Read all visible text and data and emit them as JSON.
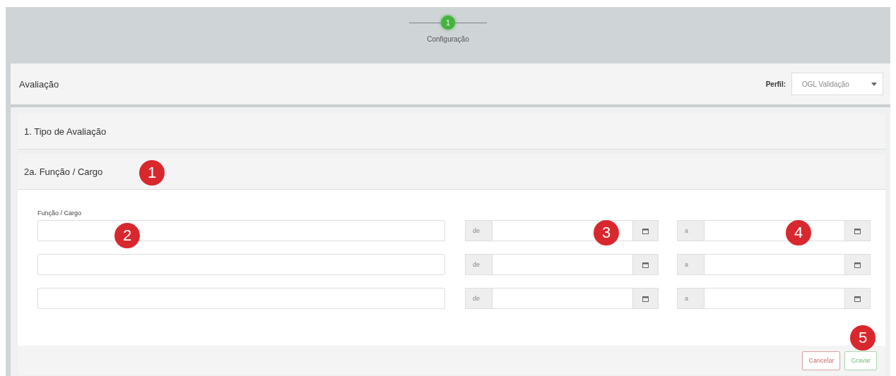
{
  "stepper": {
    "steps": [
      {
        "number": "1",
        "label": "Configuração",
        "selected": true
      }
    ]
  },
  "panel": {
    "title": "Avaliação",
    "profile_label": "Perfil:",
    "profile_value": "OGL Validação"
  },
  "sections": [
    {
      "title": "1. Tipo de Avaliação"
    },
    {
      "title": "2a. Função / Cargo",
      "field_label": "Função / Cargo",
      "rows": [
        {
          "from_prefix": "de",
          "to_prefix": "a"
        },
        {
          "from_prefix": "de",
          "to_prefix": "a"
        },
        {
          "from_prefix": "de",
          "to_prefix": "a"
        }
      ]
    }
  ],
  "buttons": [
    {
      "label": "Cancelar",
      "kind": "cancel"
    },
    {
      "label": "Gravar",
      "kind": "save"
    }
  ],
  "annotations": [
    "1",
    "2",
    "3",
    "4",
    "5"
  ]
}
